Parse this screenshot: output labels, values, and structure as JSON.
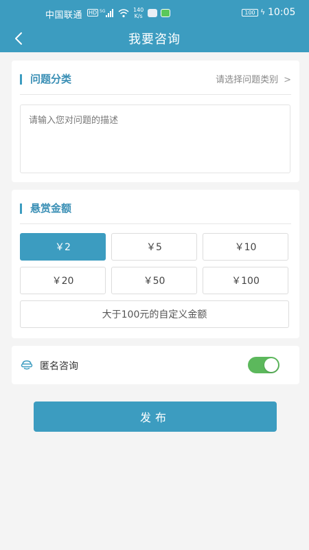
{
  "status_bar": {
    "carrier": "中国联通",
    "hd_badge": "HD",
    "network": "5G",
    "speed_value": "140",
    "speed_unit": "K/s",
    "battery": "100",
    "time": "10:05"
  },
  "header": {
    "title": "我要咨询",
    "back_icon": "chevron-left-icon",
    "background_color": "#3c9cc0"
  },
  "category": {
    "title": "问题分类",
    "select_placeholder": "请选择问题类别",
    "description_placeholder": "请输入您对问题的描述"
  },
  "reward": {
    "title": "悬赏金额",
    "options": [
      "￥2",
      "￥5",
      "￥10",
      "￥20",
      "￥50",
      "￥100"
    ],
    "selected": "￥2",
    "custom_label": "大于100元的自定义金额"
  },
  "anonymous": {
    "label": "匿名咨询",
    "icon": "mask-icon",
    "enabled": true
  },
  "submit": {
    "label": "发布"
  },
  "colors": {
    "accent": "#3c9cc0",
    "toggle_on": "#5cb85c",
    "background": "#f4f4f4"
  }
}
